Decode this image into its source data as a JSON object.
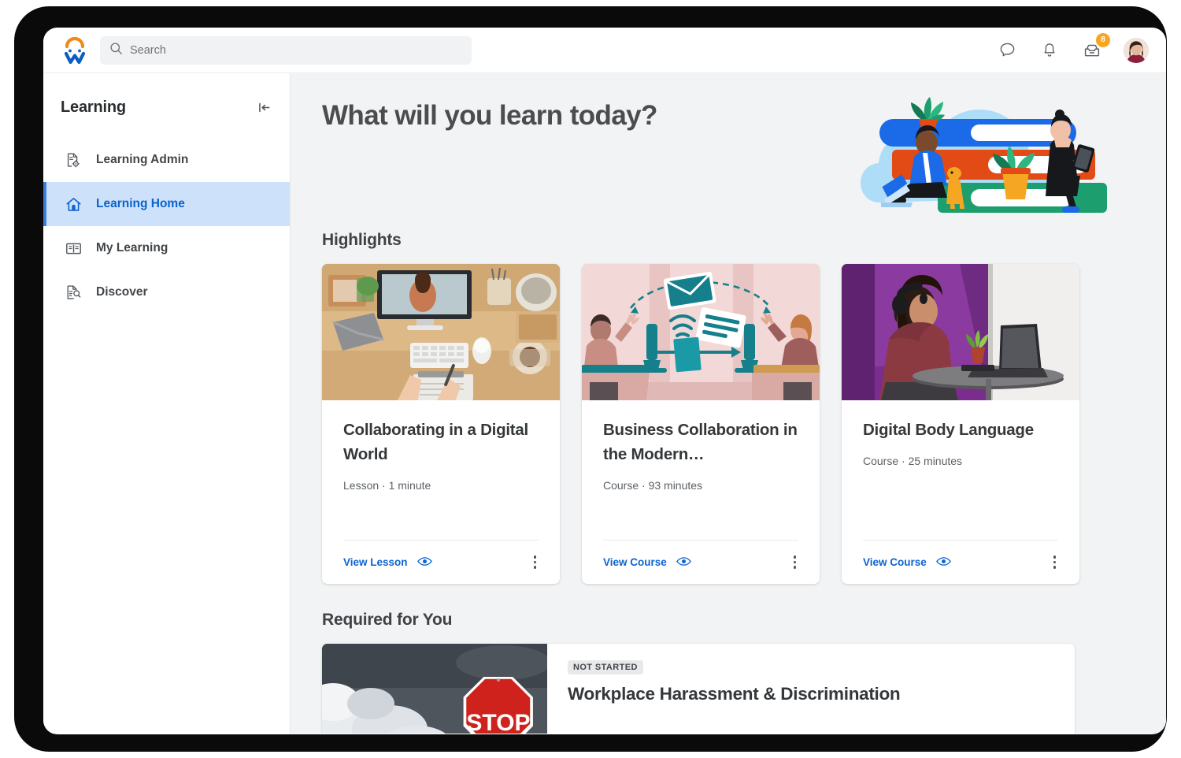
{
  "app": {
    "logo": "workday-w-logo",
    "logo_arc_color": "#f08a1c",
    "logo_w_color": "#0b5fc1"
  },
  "search": {
    "placeholder": "Search",
    "value": "",
    "icon": "search-icon"
  },
  "topbar": {
    "icons": [
      {
        "name": "chat-icon",
        "label": "Chat"
      },
      {
        "name": "notifications-bell-icon",
        "label": "Notifications"
      },
      {
        "name": "inbox-icon",
        "label": "Inbox",
        "badge": "8",
        "badge_color": "#f5a623"
      }
    ],
    "avatar_label": "Profile"
  },
  "sidebar": {
    "title": "Learning",
    "collapse_icon": "collapse-panel-icon",
    "items": [
      {
        "label": "Learning Admin",
        "icon": "document-gear-icon",
        "active": false
      },
      {
        "label": "Learning Home",
        "icon": "home-icon",
        "active": true
      },
      {
        "label": "My Learning",
        "icon": "open-book-icon",
        "active": false
      },
      {
        "label": "Discover",
        "icon": "document-search-icon",
        "active": false
      }
    ],
    "active_bg": "#cde2fa",
    "active_text": "#0a62cc"
  },
  "main": {
    "hero_title": "What will you learn today?",
    "hero_illustration": "people-reading-on-books-illustration",
    "sections": [
      {
        "id": "highlights",
        "title": "Highlights"
      },
      {
        "id": "required",
        "title": "Required for You"
      }
    ],
    "highlight_cards": [
      {
        "title": "Collaborating in a Digital World",
        "type": "Lesson",
        "duration": "1 minute",
        "meta": "Lesson · 1 minute",
        "action_label": "View Lesson",
        "action_icon": "eye-icon",
        "menu_icon": "kebab-menu-icon",
        "thumbnail": "desk-with-monitor-video-call-photo"
      },
      {
        "title": "Business Collaboration in the Modern…",
        "type": "Course",
        "duration": "93 minutes",
        "meta": "Course · 93 minutes",
        "action_label": "View Course",
        "action_icon": "eye-icon",
        "menu_icon": "kebab-menu-icon",
        "thumbnail": "two-people-exchanging-email-illustration"
      },
      {
        "title": "Digital Body Language",
        "type": "Course",
        "duration": "25 minutes",
        "meta": "Course · 25 minutes",
        "action_label": "View Course",
        "action_icon": "eye-icon",
        "menu_icon": "kebab-menu-icon",
        "thumbnail": "woman-with-headphones-at-laptop-photo"
      }
    ],
    "required_items": [
      {
        "status": "NOT STARTED",
        "title": "Workplace Harassment & Discrimination",
        "thumbnail": "stop-sign-stormy-sky-photo"
      }
    ]
  },
  "colors": {
    "accent_blue": "#0b64d0",
    "page_bg": "#f2f3f4",
    "card_bg": "#ffffff",
    "text_dark": "#35383b",
    "text_muted": "#5b6065"
  }
}
